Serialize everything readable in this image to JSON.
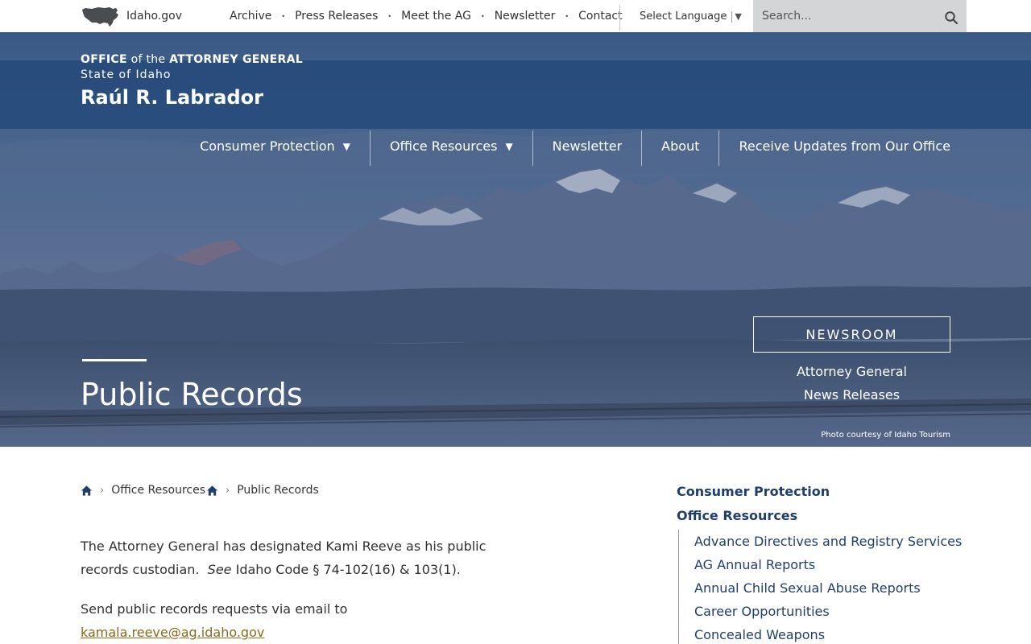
{
  "utility": {
    "idaho_label": "Idaho.gov",
    "links": [
      "Archive",
      "Press Releases",
      "Meet the AG",
      "Newsletter",
      "Contact"
    ],
    "language_label": "Select Language",
    "language_arrow": "▼",
    "search_placeholder": "Search..."
  },
  "brand": {
    "office_bold": "OFFICE",
    "of_the": " of the ",
    "attorney_general": "ATTORNEY GENERAL",
    "state": "State of Idaho",
    "name": "Raúl R. Labrador"
  },
  "main_nav": [
    {
      "label": "Consumer Protection",
      "caret": "▼"
    },
    {
      "label": "Office Resources",
      "caret": "▼"
    },
    {
      "label": "Newsletter"
    },
    {
      "label": "About"
    },
    {
      "label": "Receive Updates from Our Office"
    }
  ],
  "hero": {
    "page_title": "Public Records",
    "newsroom_button": "NEWSROOM",
    "newsroom_links": [
      "Attorney General",
      "News Releases"
    ],
    "photo_credit": "Photo courtesy of Idaho Tourism"
  },
  "breadcrumb": {
    "separator": ">",
    "items": [
      "Office Resources",
      "Public Records"
    ]
  },
  "content": {
    "p1_text": "The Attorney General has designated Kami Reeve as his public records custodian.",
    "p1_see": "See",
    "p1_code": "Idaho Code § 74-102(16) & 103(1).",
    "p2_text": "Send public records requests via email to",
    "p2_email": "kamala.reeve@ag.idaho.gov"
  },
  "sidebar": {
    "sections": [
      "Consumer Protection",
      "Office Resources"
    ],
    "office_resources_items": [
      "Advance Directives and Registry Services",
      "AG Annual Reports",
      "Annual Child Sexual Abuse Reports",
      "Career Opportunities",
      "Concealed Weapons"
    ]
  },
  "colors": {
    "brand_band": "#254a7a",
    "nav_text": "#ffffff",
    "sidebar_link": "#1f3f6a",
    "email_link": "#8a6a1b"
  }
}
